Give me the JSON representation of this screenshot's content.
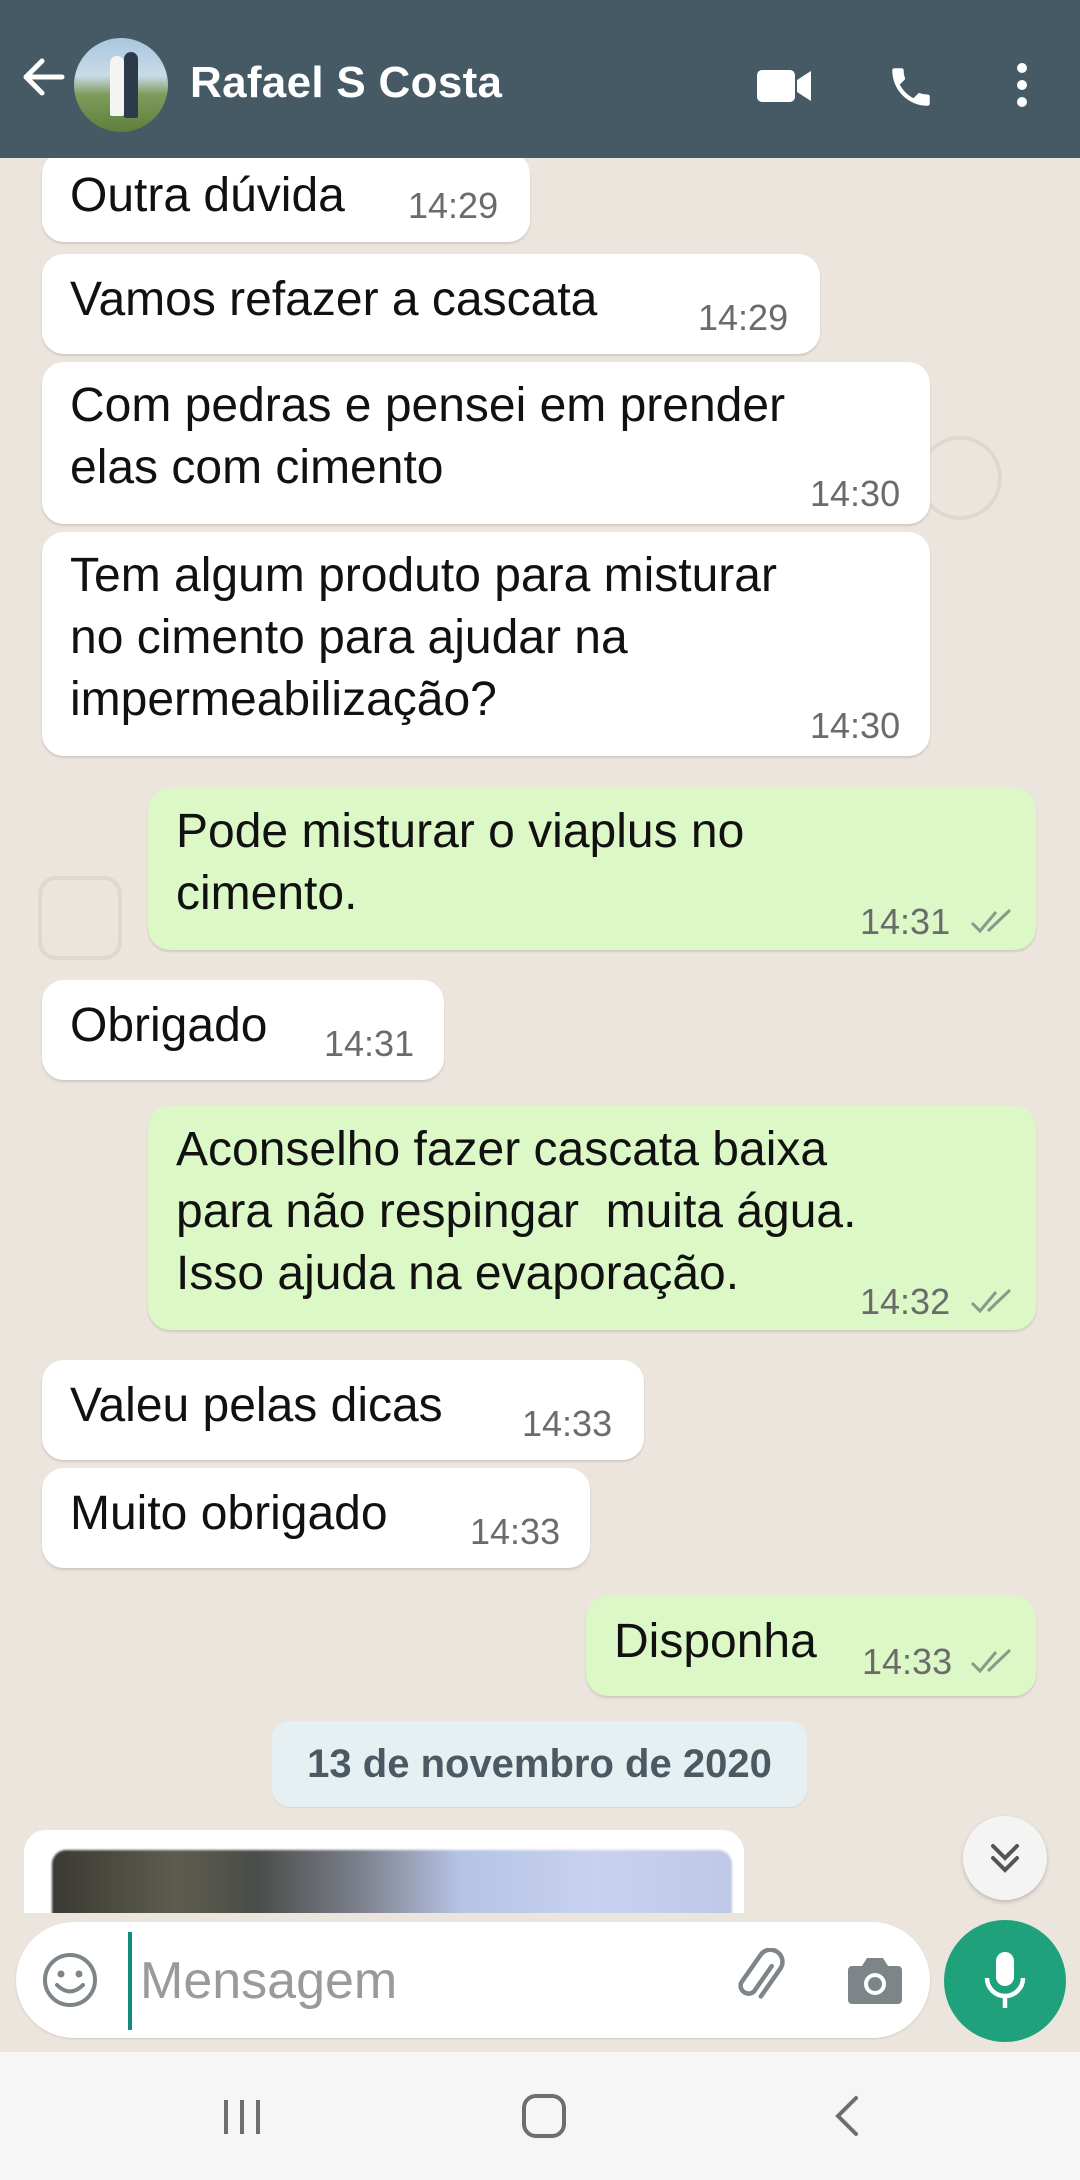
{
  "header": {
    "contact_name": "Rafael S Costa",
    "icons": [
      "back-arrow-icon",
      "avatar",
      "video-call-icon",
      "voice-call-icon",
      "more-options-icon"
    ]
  },
  "messages": [
    {
      "dir": "in",
      "lines": [
        "Outra dúvida"
      ],
      "time": "14:29"
    },
    {
      "dir": "in",
      "lines": [
        "Vamos refazer a cascata"
      ],
      "time": "14:29"
    },
    {
      "dir": "in",
      "lines": [
        "Com pedras e pensei em prender",
        "elas com cimento"
      ],
      "time": "14:30"
    },
    {
      "dir": "in",
      "lines": [
        "Tem algum produto para misturar",
        "no cimento para ajudar na",
        "impermeabilização?"
      ],
      "time": "14:30"
    },
    {
      "dir": "out",
      "lines": [
        "Pode misturar o viaplus no",
        "cimento."
      ],
      "time": "14:31",
      "status": "read"
    },
    {
      "dir": "in",
      "lines": [
        "Obrigado"
      ],
      "time": "14:31"
    },
    {
      "dir": "out",
      "lines": [
        "Aconselho fazer cascata baixa",
        "para não respingar  muita água.",
        "Isso ajuda na evaporação."
      ],
      "time": "14:32",
      "status": "read"
    },
    {
      "dir": "in",
      "lines": [
        "Valeu pelas dicas"
      ],
      "time": "14:33"
    },
    {
      "dir": "in",
      "lines": [
        "Muito obrigado"
      ],
      "time": "14:33"
    },
    {
      "dir": "out",
      "lines": [
        "Disponha"
      ],
      "time": "14:33",
      "status": "read"
    }
  ],
  "date_separator": "13 de novembro de 2020",
  "composer": {
    "placeholder": "Mensagem",
    "icons": [
      "emoji-icon",
      "attach-icon",
      "camera-icon",
      "mic-icon"
    ]
  },
  "nav": {
    "icons": [
      "recent-apps-icon",
      "home-icon",
      "back-icon"
    ]
  },
  "colors": {
    "header": "#455a64",
    "chat_bg": "#ece5dd",
    "incoming_bubble": "#ffffff",
    "outgoing_bubble": "#dcf8c6",
    "mic_button": "#1fa17c",
    "read_tick": "#8a9a8a"
  }
}
